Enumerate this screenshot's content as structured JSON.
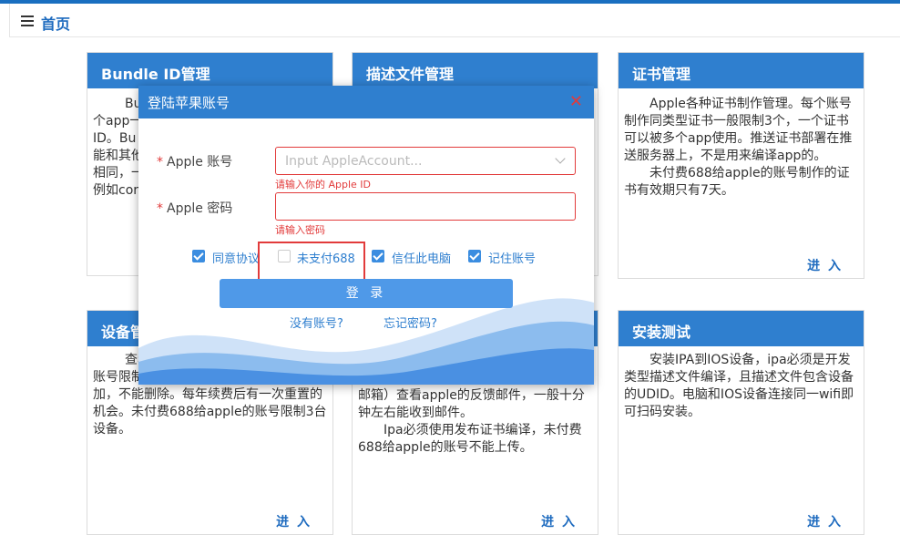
{
  "header": {
    "title": "首页"
  },
  "cards": {
    "bundle": {
      "title": "Bundle ID管理",
      "lines": [
        "Bu",
        "个app一",
        "ID。Bu",
        "能和其他",
        "相同，一",
        "例如cor"
      ]
    },
    "profile": {
      "title": "描述文件管理"
    },
    "cert": {
      "title": "证书管理",
      "p1": "Apple各种证书制作管理。每个账号制作同类型证书一般限制3个，一个证书可以被多个app使用。推送证书部署在推送服务器上，不是用来编译app的。",
      "p2": "未付费688给apple的账号制作的证书有效期只有7天。",
      "enter": "进 入"
    },
    "device": {
      "title": "设备管",
      "lines": [
        "查看",
        "账号限制",
        "加，不能删除。每年续费后有一次重置的机会。未付费688给apple的账号限制3台设备。"
      ],
      "enter": "进 入"
    },
    "publish": {
      "lines": [
        "邮箱）查看apple的反馈邮件，一般十分钟左右能收到邮件。",
        "Ipa必须使用发布证书编译，未付费688给apple的账号不能上传。"
      ],
      "enter": "进 入"
    },
    "install": {
      "title": "安装测试",
      "p1": "安装IPA到IOS设备，ipa必须是开发类型描述文件编译，且描述文件包含设备的UDID。电脑和IOS设备连接同一wifi即可扫码安装。",
      "enter": "进 入"
    }
  },
  "modal": {
    "title": "登陆苹果账号",
    "close": "✕",
    "account_label": "Apple 账号",
    "account_placeholder": "Input AppleAccount...",
    "account_error": "请输入你的 Apple ID",
    "password_label": "Apple 密码",
    "password_error": "请输入密码",
    "star": "*",
    "checks": [
      {
        "label": "同意协议",
        "checked": true
      },
      {
        "label": "未支付688",
        "checked": false
      },
      {
        "label": "信任此电脑",
        "checked": true
      },
      {
        "label": "记住账号",
        "checked": true
      }
    ],
    "login": "登 录",
    "no_account": "没有账号?",
    "forgot": "忘记密码?"
  },
  "colors": {
    "brand": "#2f7fcf",
    "error": "#e23b3b",
    "button": "#4f99e8"
  }
}
